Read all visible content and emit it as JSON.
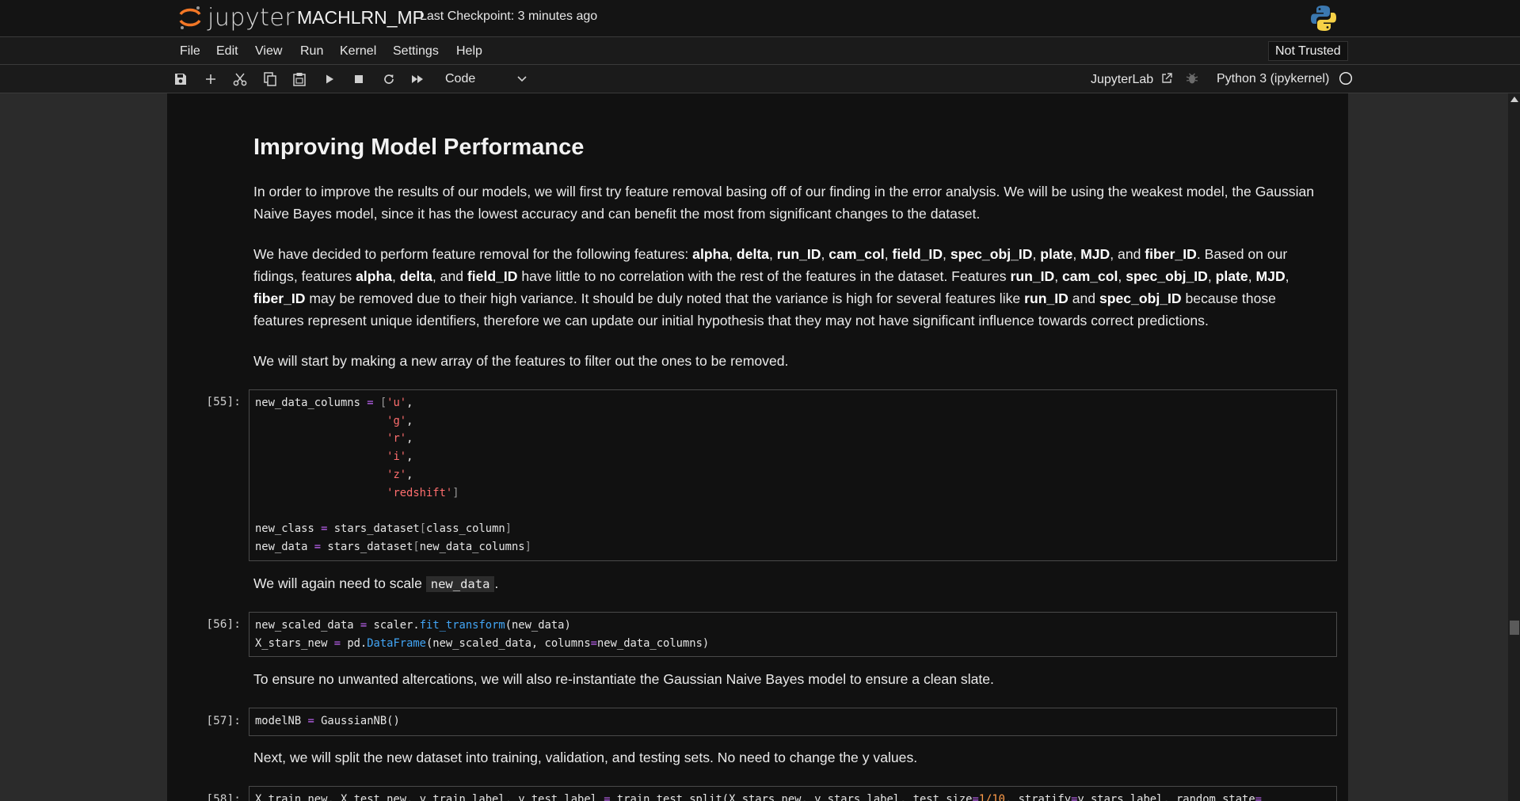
{
  "header": {
    "logo_text": "jupyter",
    "notebook_title": "MACHLRN_MP",
    "checkpoint": "Last Checkpoint: 3 minutes ago"
  },
  "menu": {
    "items": [
      "File",
      "Edit",
      "View",
      "Run",
      "Kernel",
      "Settings",
      "Help"
    ],
    "trust_status": "Not Trusted"
  },
  "toolbar": {
    "buttons": [
      "save-icon",
      "add-cell-icon",
      "cut-icon",
      "copy-icon",
      "paste-icon",
      "run-icon",
      "stop-icon",
      "restart-icon",
      "fast-forward-icon"
    ],
    "cell_type": "Code",
    "jupyterlab_link": "JupyterLab",
    "kernel_name": "Python 3 (ipykernel)"
  },
  "notebook": {
    "heading": "Improving Model Performance",
    "para1": "In order to improve the results of our models, we will first try feature removal basing off of our finding in the error analysis. We will be using the weakest model, the Gaussian Naive Bayes model, since it has the lowest accuracy and can benefit the most from significant changes to the dataset.",
    "para2": {
      "t1": "We have decided to perform feature removal for the following features: ",
      "f_alpha": "alpha",
      "f_delta": "delta",
      "f_run_ID": "run_ID",
      "f_cam_col": "cam_col",
      "f_field_ID": "field_ID",
      "f_spec_obj_ID": "spec_obj_ID",
      "f_plate": "plate",
      "f_MJD": "MJD",
      "f_fiber_ID": "fiber_ID",
      "t_and": "and",
      "t2": ". Based on our fidings, features ",
      "t3": " have little to no correlation with the rest of the features in the dataset. Features ",
      "t4": " may be removed due to their high variance. It should be duly noted that the variance is high for several features like ",
      "t5": " because those features represent unique identifiers, therefore we can update our initial hypothesis that they may not have significant influence towards correct predictions."
    },
    "para3": "We will start by making a new array of the features to filter out the ones to be removed.",
    "cell55": {
      "prompt": "[55]:",
      "l1_var": "new_data_columns",
      "cols": [
        "'u'",
        "'g'",
        "'r'",
        "'i'",
        "'z'",
        "'redshift'"
      ],
      "l8_var": "new_class",
      "l8_obj": "stars_dataset",
      "l8_arg": "class_column",
      "l9_var": "new_data",
      "l9_obj": "stars_dataset",
      "l9_arg": "new_data_columns"
    },
    "para4_pre": "We will again need to scale ",
    "para4_code": "new_data",
    "para4_post": ".",
    "cell56": {
      "prompt": "[56]:",
      "l1_var": "new_scaled_data",
      "l1_obj": "scaler.",
      "l1_fn": "fit_transform",
      "l1_arg": "(new_data)",
      "l2_var": "X_stars_new",
      "l2_obj": "pd.",
      "l2_fn": "DataFrame",
      "l2_arg1": "(new_scaled_data, columns",
      "l2_arg2": "new_data_columns)"
    },
    "para5": "To ensure no unwanted altercations, we will also re-instantiate the Gaussian Naive Bayes model to ensure a clean slate.",
    "cell57": {
      "prompt": "[57]:",
      "l1_var": "modelNB",
      "l1_rhs": "GaussianNB()"
    },
    "para6": "Next, we will split the new dataset into training, validation, and testing sets. No need to change the y values.",
    "cell58": {
      "prompt": "[58]:",
      "l1_a": "X_train_new, X_test_new, y_train_label, y_test_label",
      "l1_b": "train_test_split(X_stars_new, y_stars_label, test_size",
      "l1_c": "1/10",
      "l1_d": ", stratify",
      "l1_e": "y_stars_label, random_state"
    }
  },
  "colors": {
    "page_bg": "#111111",
    "gutter_bg": "#2b2b2b",
    "keyword_purple": "#c768ff",
    "string_red": "#ff6e6e",
    "function_blue": "#42a5f5",
    "number_orange": "#ff9c4a"
  }
}
